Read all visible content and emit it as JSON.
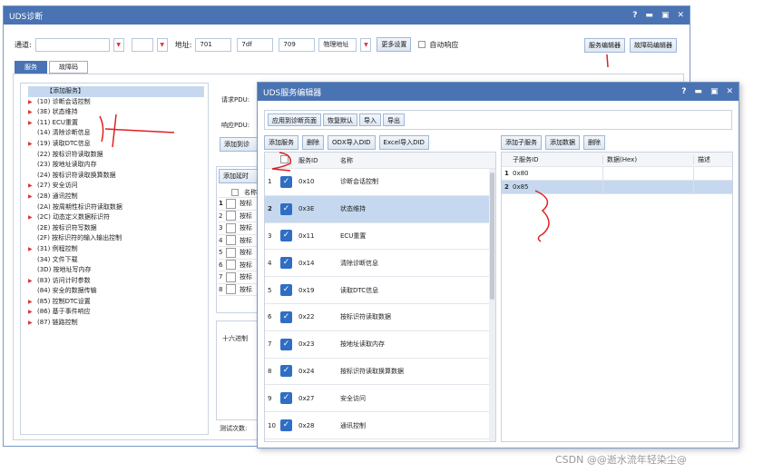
{
  "main_window": {
    "title": "UDS诊断",
    "controls": [
      "?",
      "▬",
      "▣",
      "✕"
    ],
    "channel_label": "通道:",
    "address_label": "地址:",
    "address_values": [
      "701",
      "7df",
      "709"
    ],
    "address_type": "物理地址",
    "more_settings": "更多设置",
    "auto_resp_label": "自动响应",
    "service_editor_btn": "服务编辑器",
    "dtc_editor_btn": "故障码编辑器",
    "tabs": [
      "服务",
      "故障码"
    ]
  },
  "tree": {
    "items": [
      {
        "label": "【添加服务】",
        "arrow": false
      },
      {
        "label": "(10) 诊断会话控制",
        "arrow": true
      },
      {
        "label": "(3E) 状态维持",
        "arrow": true
      },
      {
        "label": "(11) ECU重置",
        "arrow": true
      },
      {
        "label": "(14) 清除诊断信息",
        "arrow": false
      },
      {
        "label": "(19) 读取DTC信息",
        "arrow": true
      },
      {
        "label": "(22) 按标识符读取数据",
        "arrow": false
      },
      {
        "label": "(23) 按地址读取内存",
        "arrow": false
      },
      {
        "label": "(24) 按标识符读取换算数据",
        "arrow": false
      },
      {
        "label": "(27) 安全访问",
        "arrow": true
      },
      {
        "label": "(28) 通讯控制",
        "arrow": true
      },
      {
        "label": "(2A) 按周期性标识符读取数据",
        "arrow": false
      },
      {
        "label": "(2C) 动态定义数据标识符",
        "arrow": true
      },
      {
        "label": "(2E) 按标识符写数据",
        "arrow": false
      },
      {
        "label": "(2F) 按标识符的输入输出控制",
        "arrow": false
      },
      {
        "label": "(31) 例程控制",
        "arrow": true
      },
      {
        "label": "(34) 文件下载",
        "arrow": false
      },
      {
        "label": "(3D) 按地址写内存",
        "arrow": false
      },
      {
        "label": "(83) 访问计时参数",
        "arrow": true
      },
      {
        "label": "(84) 安全的数据传输",
        "arrow": false
      },
      {
        "label": "(85) 控制DTC设置",
        "arrow": true
      },
      {
        "label": "(86) 基于事件响应",
        "arrow": true
      },
      {
        "label": "(87) 链路控制",
        "arrow": true
      }
    ]
  },
  "middle": {
    "request_pdu": "请求PDU:",
    "response_pdu": "响应PDU:",
    "add_trigger": "添加到诊",
    "add_timer": "添加延时",
    "name_col": "名称",
    "rows": [
      "1",
      "2",
      "3",
      "4",
      "5",
      "6",
      "7",
      "8"
    ],
    "row_text": [
      "按标",
      "按标",
      "按标",
      "按标",
      "按标",
      "按标",
      "按标",
      "按标"
    ],
    "hex_label": "十六进制",
    "test_count": "测试次数:"
  },
  "editor": {
    "title": "UDS服务编辑器",
    "controls": [
      "?",
      "▬",
      "▣",
      "✕"
    ],
    "toolbar": [
      "应用到诊断页面",
      "恢复默认",
      "导入",
      "导出"
    ],
    "left_btns": [
      "添加服务",
      "删除",
      "ODX导入DID",
      "Excel导入DID"
    ],
    "right_btns": [
      "添加子服务",
      "添加数据",
      "删除"
    ],
    "left_headers": [
      "服务ID",
      "名称"
    ],
    "services": [
      {
        "n": "1",
        "id": "0x10",
        "name": "诊断会话控制"
      },
      {
        "n": "2",
        "id": "0x3E",
        "name": "状态维持"
      },
      {
        "n": "3",
        "id": "0x11",
        "name": "ECU重置"
      },
      {
        "n": "4",
        "id": "0x14",
        "name": "清除诊断信息"
      },
      {
        "n": "5",
        "id": "0x19",
        "name": "读取DTC信息"
      },
      {
        "n": "6",
        "id": "0x22",
        "name": "按标识符读取数据"
      },
      {
        "n": "7",
        "id": "0x23",
        "name": "按地址读取内存"
      },
      {
        "n": "8",
        "id": "0x24",
        "name": "按标识符读取换算数据"
      },
      {
        "n": "9",
        "id": "0x27",
        "name": "安全访问"
      },
      {
        "n": "10",
        "id": "0x28",
        "name": "通讯控制"
      }
    ],
    "right_headers": [
      "子服务ID",
      "数据(Hex)",
      "描述"
    ],
    "subservices": [
      {
        "n": "1",
        "id": "0x80"
      },
      {
        "n": "2",
        "id": "0x85"
      }
    ]
  },
  "watermark": "CSDN @@逝水流年轻染尘@"
}
